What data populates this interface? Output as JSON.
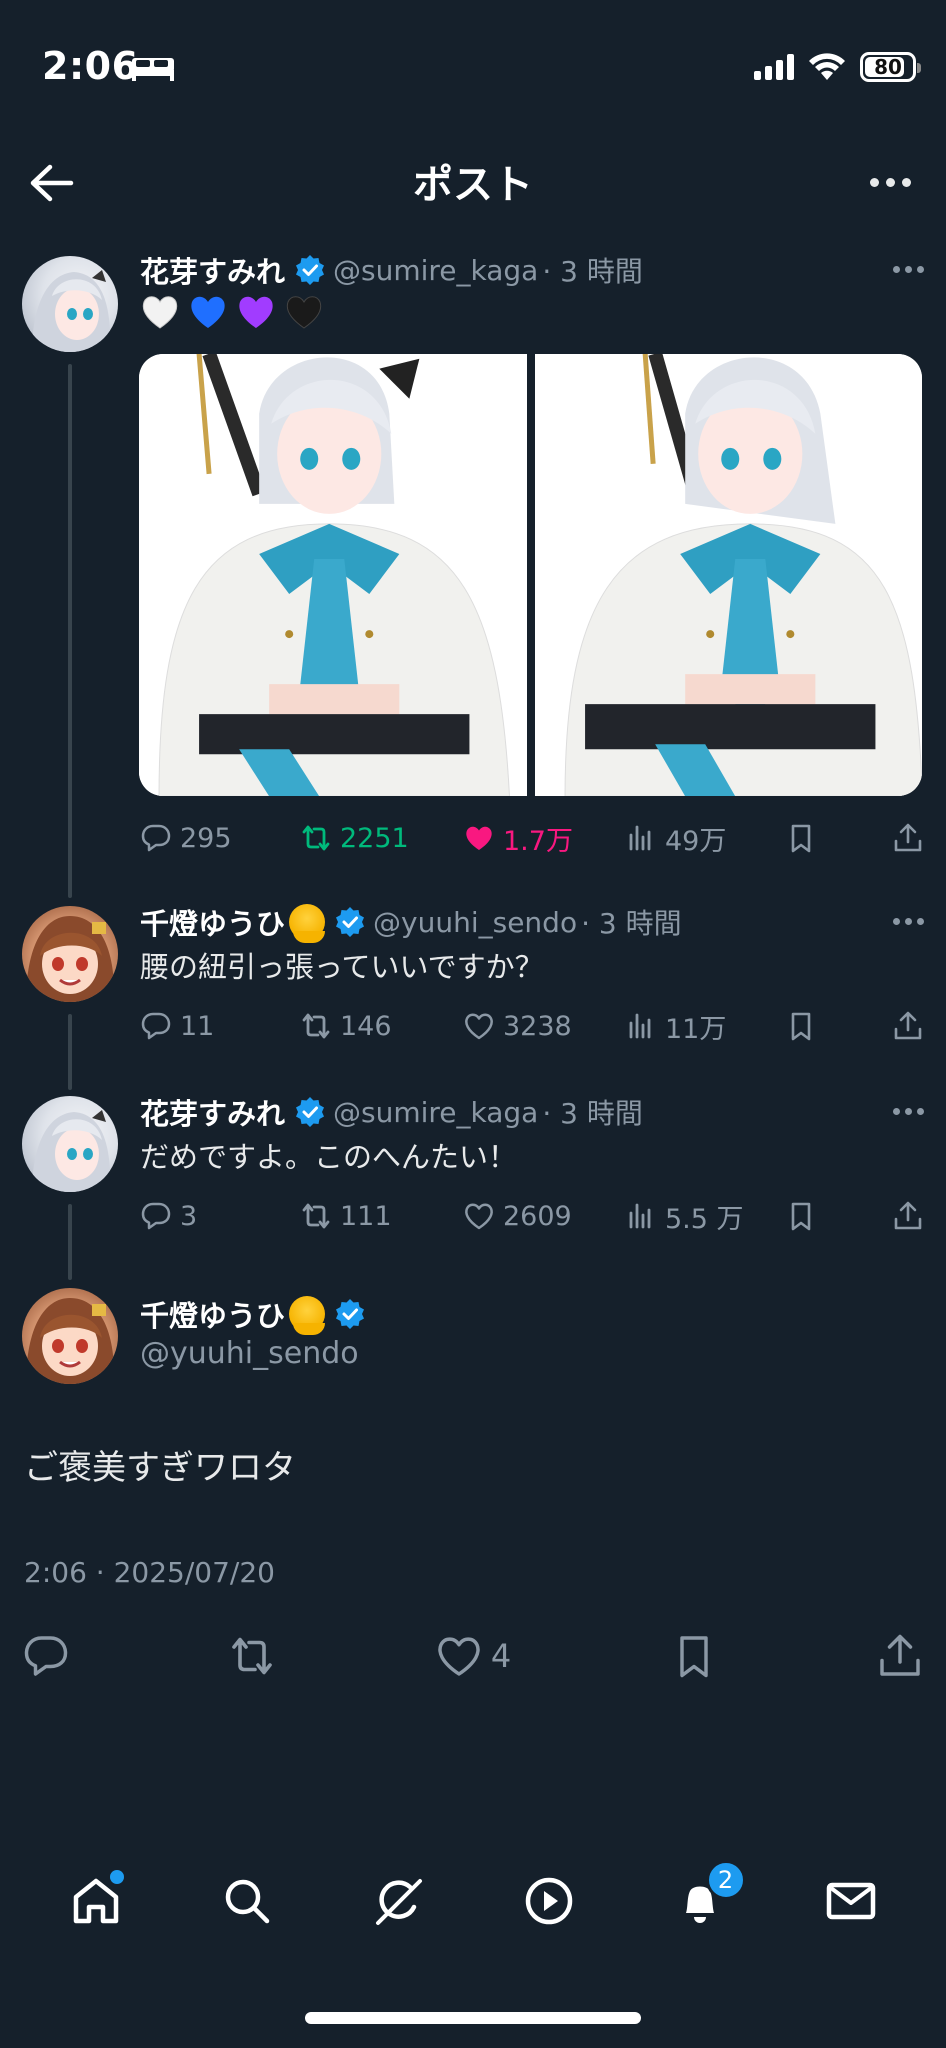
{
  "status_bar": {
    "time": "2:06",
    "battery": "80"
  },
  "header": {
    "title": "ポスト"
  },
  "tweets": [
    {
      "name": "花芽すみれ",
      "handle": "@sumire_kaga",
      "time": "· 3 時間",
      "emoji_text": "🤍💙💜🖤",
      "hearts": [
        {
          "icon": "white-heart-emoji",
          "color": "#f2f2f2"
        },
        {
          "icon": "blue-heart-emoji",
          "color": "#1f6fff"
        },
        {
          "icon": "purple-heart-emoji",
          "color": "#a13cff"
        },
        {
          "icon": "black-heart-emoji",
          "color": "#1a1a1a"
        }
      ],
      "replies": "295",
      "retweets": "2251",
      "likes": "1.7万",
      "views": "49万",
      "liked": true,
      "retweeted": true
    },
    {
      "name": "千燈ゆうひ",
      "handle": "@yuuhi_sendo",
      "time": "· 3 時間",
      "text": "腰の紐引っ張っていいですか？",
      "replies": "11",
      "retweets": "146",
      "likes": "3238",
      "views": "11万"
    },
    {
      "name": "花芽すみれ",
      "handle": "@sumire_kaga",
      "time": "· 3 時間",
      "text": "だめですよ。このへんたい！",
      "replies": "3",
      "retweets": "111",
      "likes": "2609",
      "views": "5.5 万"
    }
  ],
  "main_tweet": {
    "name": "千燈ゆうひ",
    "handle": "@yuuhi_sendo",
    "text": "ご褒美すぎワロタ",
    "timestamp": "2:06 · 2025/07/20",
    "likes": "4"
  },
  "bottom_nav": {
    "items": [
      "home-icon",
      "search-icon",
      "grok-icon",
      "video-icon",
      "notifications-icon",
      "messages-icon"
    ],
    "notification_badge": "2"
  },
  "colors": {
    "background": "#15202b",
    "accent": "#1d9bf0",
    "like": "#f91880",
    "retweet": "#00ba7c",
    "muted": "#8b98a5"
  }
}
